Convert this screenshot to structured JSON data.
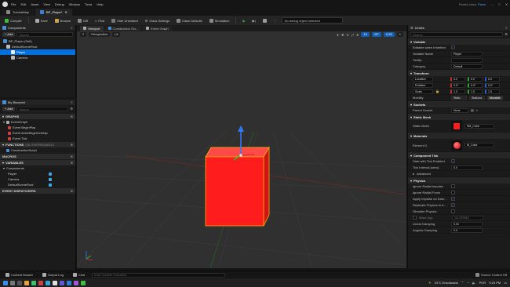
{
  "menu": {
    "items": [
      "File",
      "Edit",
      "Asset",
      "View",
      "Debug",
      "Window",
      "Tools",
      "Help"
    ],
    "parent_label": "Parent class:",
    "parent_value": "Pawn"
  },
  "tabs": [
    {
      "label": "TutorialMap",
      "active": false
    },
    {
      "label": "BP_Player*",
      "active": true
    }
  ],
  "toolbar": {
    "compile": "Compile",
    "save": "Save",
    "browse": "Browse",
    "diff": "Diff",
    "find": "Find",
    "hide_unrelated": "Hide Unrelated",
    "class_settings": "Class Settings",
    "class_defaults": "Class Defaults",
    "simulation": "Simulation",
    "debug_object": "No debug object selected"
  },
  "components": {
    "title": "Components",
    "add": "+ Add",
    "search_placeholder": "Search",
    "items": [
      {
        "label": "BP_Player (Self)",
        "depth": 0,
        "selected": false
      },
      {
        "label": "DefaultSceneRoot",
        "depth": 1,
        "selected": false
      },
      {
        "label": "Player",
        "depth": 2,
        "selected": true
      },
      {
        "label": "Camera",
        "depth": 2,
        "selected": false
      }
    ]
  },
  "blueprint": {
    "title": "My Blueprint",
    "add": "+ Add",
    "search_placeholder": "Search",
    "graphs_label": "GRAPHS",
    "event_graph": "EventGraph",
    "events": [
      "Event BeginPlay",
      "Event ActorBeginOverlap",
      "Event Tick"
    ],
    "functions_label": "FUNCTIONS",
    "functions_count": "(26 OVERRIDABLE)",
    "construction_script": "ConstructionScript",
    "macros_label": "MACROS",
    "variables_label": "VARIABLES",
    "components_label": "Components",
    "variables": [
      "Player",
      "Camera",
      "DefaultSceneRoot"
    ],
    "dispatchers_label": "EVENT DISPATCHERS"
  },
  "viewport": {
    "tabs": [
      {
        "label": "Viewport",
        "active": true
      },
      {
        "label": "Construction Scr...",
        "active": false
      },
      {
        "label": "Event Graph",
        "active": false
      }
    ],
    "perspective": "Perspective",
    "lit": "Lit",
    "snap_grid": "10",
    "snap_rot": "10°",
    "snap_scale": "0.25",
    "cam_speed": "1",
    "cube_color": "#ff1c1c"
  },
  "details": {
    "title": "Details",
    "search_placeholder": "Search",
    "variable_section": "Variable",
    "editable_when_inherited": "Editable when Inherited",
    "variable_name_label": "Variable Name",
    "variable_name": "Player",
    "tooltip_label": "Tooltip",
    "category_label": "Category",
    "category": "Default",
    "transform_section": "Transform",
    "location_label": "Location",
    "location": [
      "0.0",
      "0.0",
      "0.0"
    ],
    "rotation_label": "Rotation",
    "rotation": [
      "0.0°",
      "0.0°",
      "0.0°"
    ],
    "scale_label": "Scale",
    "scale": [
      "1.0",
      "1.0",
      "1.0"
    ],
    "mobility_label": "Mobility",
    "mobility_options": [
      "Static",
      "Stationa",
      "Movable"
    ],
    "sockets_section": "Sockets",
    "parent_socket_label": "Parent Socket",
    "parent_socket": "None",
    "static_mesh_section": "Static Mesh",
    "static_mesh_label": "Static Mesh",
    "static_mesh": "SM_Cube",
    "materials_section": "Materials",
    "element_label": "Element 0",
    "material": "M_Color",
    "tick_section": "Component Tick",
    "start_tick_label": "Start with Tick Enabled",
    "tick_interval_label": "Tick Interval (secs)",
    "tick_interval": "0.0",
    "advanced_label": "Advanced",
    "physics_section": "Physics",
    "physics_rows": [
      {
        "label": "Ignore Radial Impulse",
        "checked": false
      },
      {
        "label": "Ignore Radial Force",
        "checked": false
      },
      {
        "label": "Apply Impulse on Dam...",
        "checked": true
      },
      {
        "label": "Replicate Physics to A...",
        "checked": true
      },
      {
        "label": "Simulate Physics",
        "checked": false
      }
    ],
    "mass_label": "Mass (kg)",
    "mass": "111.007843",
    "linear_damping_label": "Linear Damping",
    "linear_damping": "0.01",
    "angular_damping_label": "Angular Damping",
    "angular_damping": "0.0"
  },
  "bottom": {
    "content_drawer": "Content Drawer",
    "output_log": "Output Log",
    "cmd": "Cmd",
    "console_placeholder": "Enter Console Command",
    "source_control": "Source Control Off"
  },
  "taskbar": {
    "weather": "23°C  Ensolarado",
    "lang": "POR",
    "time": "9:25 PM"
  },
  "colors": {
    "accent": "#0070e0",
    "play": "#3fbf3f",
    "cube": "#ff1c1c"
  }
}
